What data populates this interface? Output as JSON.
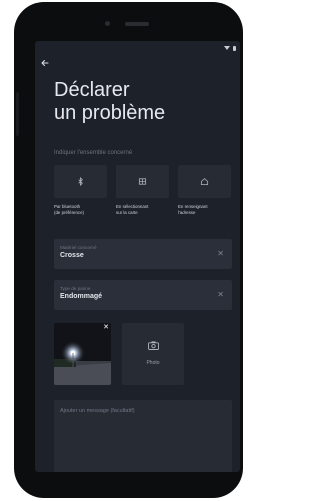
{
  "page": {
    "title_line1": "Déclarer",
    "title_line2": "un problème",
    "section_label": "Indiquer l'ensemble concerné"
  },
  "options": [
    {
      "icon": "bluetooth-icon",
      "label_line1": "Par bluetooth",
      "label_line2": "(de préférence)"
    },
    {
      "icon": "map-icon",
      "label_line1": "En sélectionnant",
      "label_line2": "sur la carte"
    },
    {
      "icon": "home-icon",
      "label_line1": "En renseignant",
      "label_line2": "l'adresse"
    }
  ],
  "fields": {
    "equipment": {
      "label": "Matériel concerné",
      "value": "Crosse"
    },
    "problem_type": {
      "label": "Type de panne",
      "value": "Endommagé"
    }
  },
  "photos": {
    "add_label": "Photo"
  },
  "message": {
    "placeholder": "Ajouter un message (facultatif)"
  }
}
